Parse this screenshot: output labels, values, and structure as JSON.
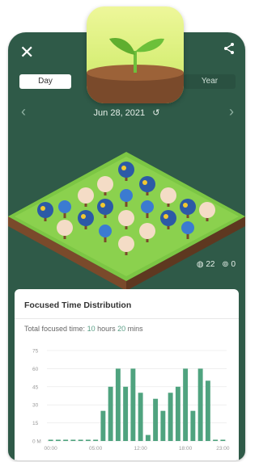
{
  "header": {
    "close_glyph": "✕",
    "tabs": [
      {
        "label": "Day",
        "active": true
      },
      {
        "label": "Year",
        "active": false
      }
    ],
    "date": "Jun 28, 2021",
    "prev_glyph": "‹",
    "next_glyph": "›",
    "return_glyph": "↺"
  },
  "forest": {
    "coins": "22",
    "dead_trees": "0"
  },
  "card": {
    "title": "Focused Time Distribution",
    "total_label": "Total focused time:",
    "hours_value": "10",
    "hours_label": "hours",
    "mins_value": "20",
    "mins_label": "mins"
  },
  "colors": {
    "background": "#2f5a48",
    "bar": "#4fa37f",
    "accent": "#5b9e86"
  },
  "chart_data": {
    "type": "bar",
    "y_ticks": [
      "75",
      "60",
      "45",
      "30",
      "15",
      "0 M"
    ],
    "ylim": [
      0,
      75
    ],
    "x_tick_labels": [
      "00:00",
      "05:00",
      "12:00",
      "18:00",
      "23:00"
    ],
    "x_tick_hours": [
      0,
      6,
      12,
      18,
      23
    ],
    "hours": [
      0,
      1,
      2,
      3,
      4,
      5,
      6,
      7,
      8,
      9,
      10,
      11,
      12,
      13,
      14,
      15,
      16,
      17,
      18,
      19,
      20,
      21,
      22,
      23
    ],
    "values": [
      0,
      0,
      0,
      0,
      0,
      0,
      0,
      25,
      45,
      60,
      45,
      60,
      40,
      5,
      35,
      25,
      40,
      45,
      60,
      25,
      60,
      50,
      0,
      0
    ]
  }
}
